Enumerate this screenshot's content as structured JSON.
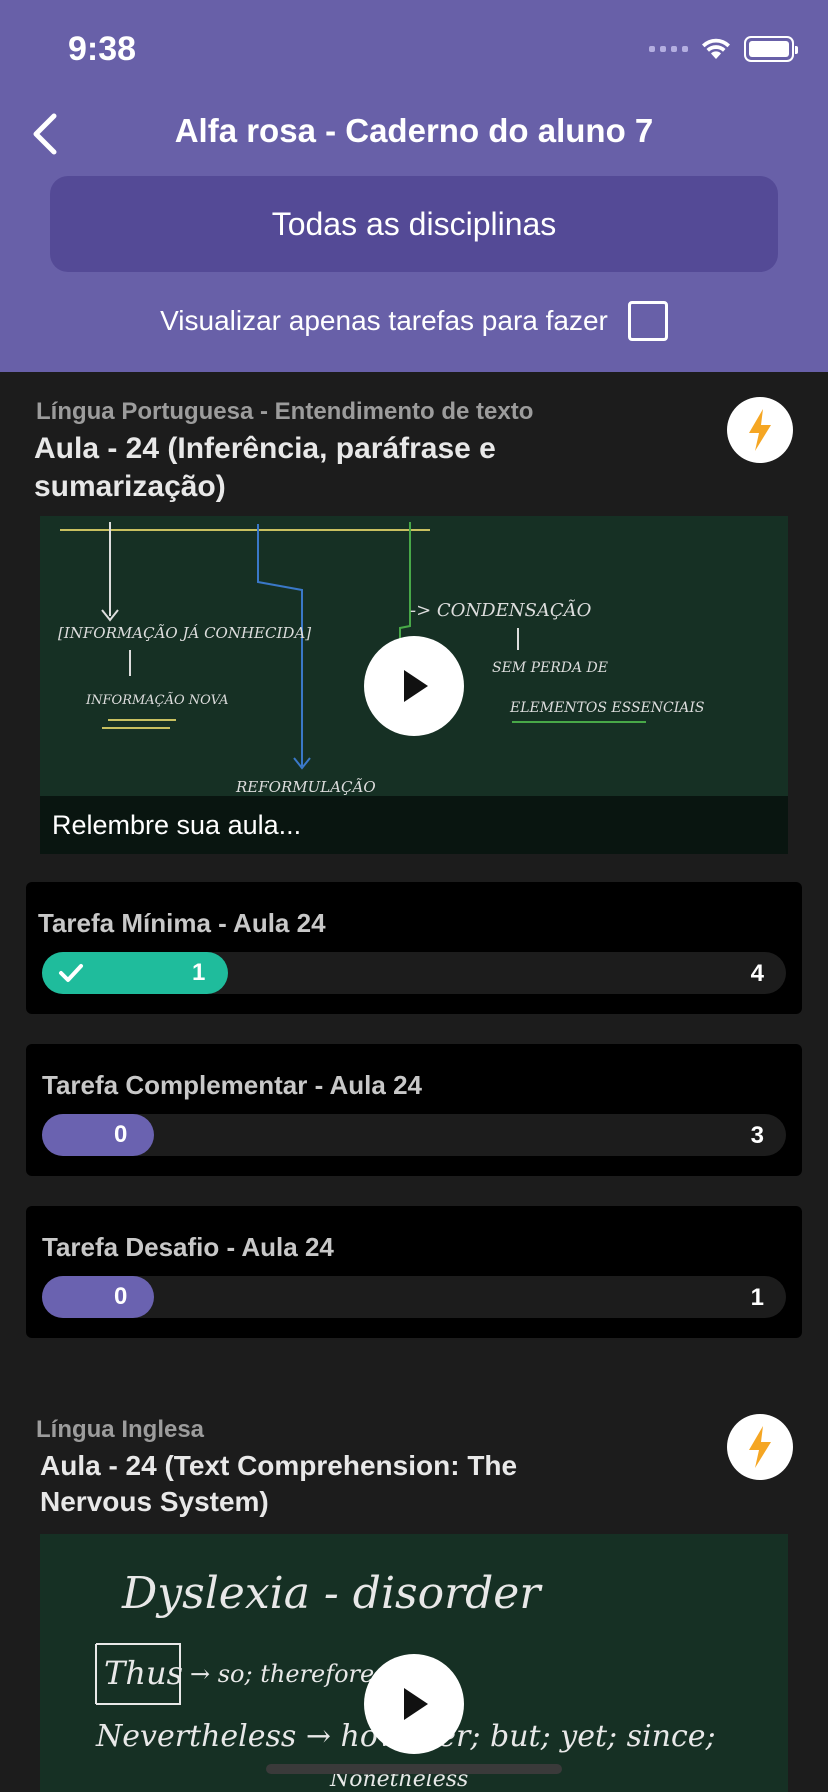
{
  "status_bar": {
    "time": "9:38"
  },
  "nav": {
    "title": "Alfa rosa - Caderno do aluno 7",
    "back_icon": "chevron-left-icon"
  },
  "discipline_selector": {
    "label": "Todas as disciplinas"
  },
  "filter": {
    "label": "Visualizar apenas tarefas para fazer",
    "checked": false
  },
  "lessons": [
    {
      "subject": "Língua Portuguesa - Entendimento de texto",
      "title_line1": "Aula - 24 (Inferência, paráfrase e",
      "title_line2": "sumarização)",
      "video_caption": "Relembre sua aula...",
      "tasks": [
        {
          "label": "Tarefa Mínima - Aula 24",
          "done": 1,
          "total": 4,
          "color": "#1fbc9c",
          "completed": true
        },
        {
          "label": "Tarefa Complementar - Aula 24",
          "done": 0,
          "total": 3,
          "color": "#6a62b0",
          "completed": false
        },
        {
          "label": "Tarefa Desafio - Aula 24",
          "done": 0,
          "total": 1,
          "color": "#6a62b0",
          "completed": false
        }
      ]
    },
    {
      "subject": "Língua Inglesa",
      "title_line1": "Aula - 24 (Text Comprehension: The",
      "title_line2": "Nervous System)"
    }
  ],
  "colors": {
    "header": "#6860a8",
    "accent_green": "#1fbc9c",
    "accent_purple": "#6a62b0",
    "bolt": "#f5a623"
  }
}
